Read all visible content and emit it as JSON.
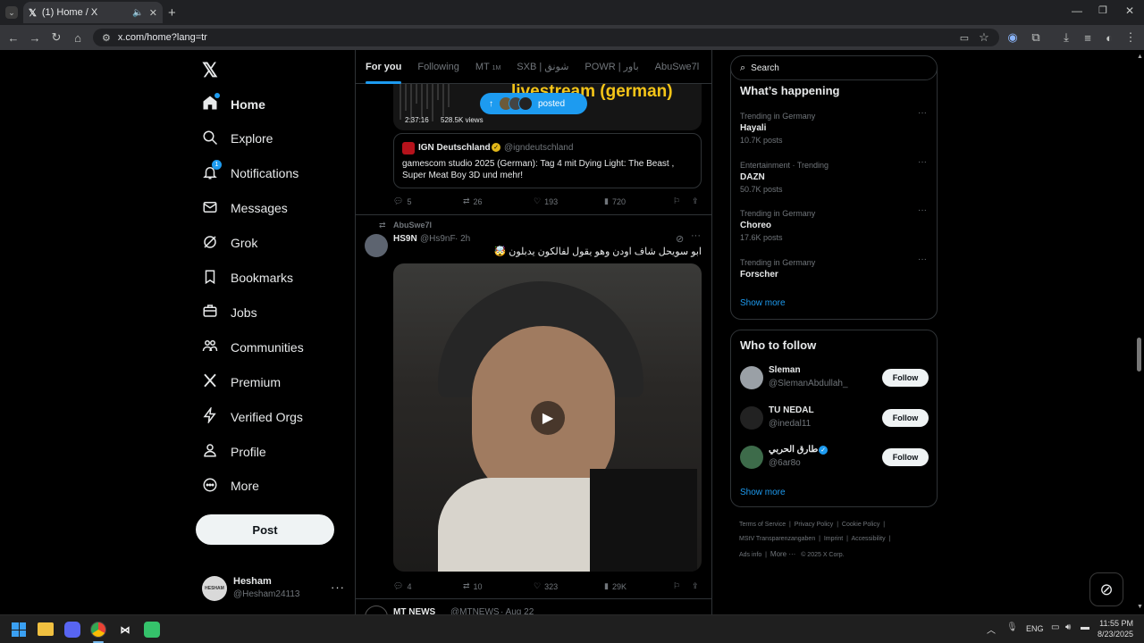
{
  "browser": {
    "tab_title": "(1) Home / X",
    "url": "x.com/home?lang=tr"
  },
  "nav": {
    "items": [
      {
        "label": "Home",
        "icon": "home-icon"
      },
      {
        "label": "Explore",
        "icon": "search-icon"
      },
      {
        "label": "Notifications",
        "icon": "bell-icon",
        "badge": "1"
      },
      {
        "label": "Messages",
        "icon": "mail-icon"
      },
      {
        "label": "Grok",
        "icon": "grok-icon"
      },
      {
        "label": "Bookmarks",
        "icon": "bookmark-icon"
      },
      {
        "label": "Jobs",
        "icon": "briefcase-icon"
      },
      {
        "label": "Communities",
        "icon": "people-icon"
      },
      {
        "label": "Premium",
        "icon": "x-logo-icon"
      },
      {
        "label": "Verified Orgs",
        "icon": "bolt-icon"
      },
      {
        "label": "Profile",
        "icon": "person-icon"
      },
      {
        "label": "More",
        "icon": "more-circle-icon"
      }
    ],
    "post_label": "Post",
    "account": {
      "name": "Hesham",
      "handle": "@Hesham24113"
    }
  },
  "feed": {
    "tabs": [
      "For you",
      "Following",
      "MT",
      "SXB | شونق",
      "POWR | باور",
      "AbuSwe7l"
    ],
    "tab_mt_badge": "1M",
    "tweet1": {
      "video_title": "livestream (german)",
      "video_time": "2:37:16",
      "video_views": "528.5K views",
      "posted_pill": "posted",
      "quote_name": "IGN Deutschland",
      "quote_handle": "@igndeutschland",
      "quote_text": "gamescom studio 2025 (German): Tag 4 mit Dying Light: The Beast , Super Meat Boy 3D und mehr!",
      "replies": "5",
      "reposts": "26",
      "likes": "193",
      "views": "720"
    },
    "tweet2": {
      "social_context": "AbuSwe7l",
      "name": "HS9N",
      "handle": "@Hs9nF",
      "time": "· 2h",
      "text": "ابو سويحل شاف اودن وهو يقول لفالكون يدبلون 🤯",
      "replies": "4",
      "reposts": "10",
      "likes": "323",
      "views": "29K"
    },
    "tweet3": {
      "name": "MT NEWS",
      "handle": "@MTNEWS",
      "time": "· Aug 22"
    }
  },
  "sidebar": {
    "search_placeholder": "Search",
    "whats_happening": "What’s happening",
    "trends": [
      {
        "context": "Trending in Germany",
        "name": "Hayali",
        "posts": "10.7K posts"
      },
      {
        "context": "Entertainment · Trending",
        "name": "DAZN",
        "posts": "50.7K posts"
      },
      {
        "context": "Trending in Germany",
        "name": "Choreo",
        "posts": "17.6K posts"
      },
      {
        "context": "Trending in Germany",
        "name": "Forscher",
        "posts": ""
      }
    ],
    "show_more": "Show more",
    "who_to_follow": "Who to follow",
    "follow": [
      {
        "name": "Sleman",
        "handle": "@SlemanAbdullah_"
      },
      {
        "name": "TU NEDAL",
        "handle": "@inedal11"
      },
      {
        "name": "طارق الحربي",
        "handle": "@6ar8o"
      }
    ],
    "follow_label": "Follow",
    "footer": [
      "Terms of Service",
      "Privacy Policy",
      "Cookie Policy",
      "MStV Transparenzangaben",
      "Imprint",
      "Accessibility",
      "Ads info",
      "More ···",
      "© 2025 X Corp."
    ]
  },
  "taskbar": {
    "lang": "ENG",
    "time": "11:55 PM",
    "date": "8/23/2025"
  }
}
